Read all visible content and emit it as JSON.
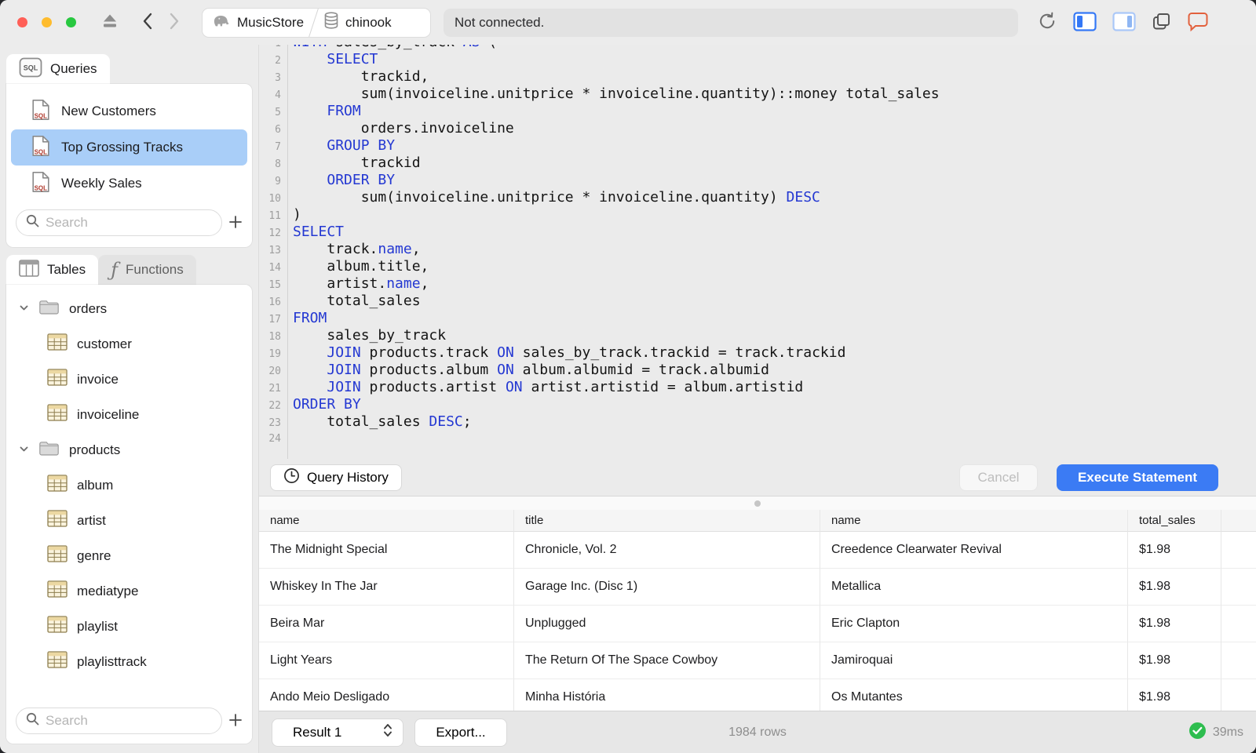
{
  "colors": {
    "accent_blue": "#3b7bf4",
    "selection_blue": "#a9cef8",
    "keyword_blue": "#2438d2",
    "success_green": "#2ebd4f",
    "chat_orange": "#e2603c",
    "traffic_red": "#ff5f57",
    "traffic_yellow": "#febc2e",
    "traffic_green": "#28c840"
  },
  "toolbar": {
    "breadcrumb": {
      "app": "MusicStore",
      "database": "chinook"
    },
    "status_field": "Not connected."
  },
  "sidebar": {
    "queries_tab_label": "Queries",
    "queries": [
      "New Customers",
      "Top Grossing Tracks",
      "Weekly Sales"
    ],
    "selected_query_index": 1,
    "queries_search_placeholder": "Search",
    "tables_tab_label": "Tables",
    "functions_tab_label": "Functions",
    "tables_search_placeholder": "Search",
    "tables_tree": [
      {
        "type": "folder",
        "label": "orders",
        "expanded": true
      },
      {
        "type": "table",
        "label": "customer"
      },
      {
        "type": "table",
        "label": "invoice"
      },
      {
        "type": "table",
        "label": "invoiceline"
      },
      {
        "type": "folder",
        "label": "products",
        "expanded": true
      },
      {
        "type": "table",
        "label": "album"
      },
      {
        "type": "table",
        "label": "artist"
      },
      {
        "type": "table",
        "label": "genre"
      },
      {
        "type": "table",
        "label": "mediatype"
      },
      {
        "type": "table",
        "label": "playlist"
      },
      {
        "type": "table",
        "label": "playlisttrack"
      }
    ]
  },
  "editor": {
    "lines": [
      [
        [
          "k",
          "WITH"
        ],
        [
          "t",
          " sales_by_track "
        ],
        [
          "k",
          "AS"
        ],
        [
          "t",
          " ("
        ]
      ],
      [
        [
          "t",
          "    "
        ],
        [
          "k",
          "SELECT"
        ]
      ],
      [
        [
          "t",
          "        trackid,"
        ]
      ],
      [
        [
          "t",
          "        sum(invoiceline.unitprice * invoiceline.quantity)::money total_sales"
        ]
      ],
      [
        [
          "t",
          "    "
        ],
        [
          "k",
          "FROM"
        ]
      ],
      [
        [
          "t",
          "        orders.invoiceline"
        ]
      ],
      [
        [
          "t",
          "    "
        ],
        [
          "k",
          "GROUP BY"
        ]
      ],
      [
        [
          "t",
          "        trackid"
        ]
      ],
      [
        [
          "t",
          "    "
        ],
        [
          "k",
          "ORDER BY"
        ]
      ],
      [
        [
          "t",
          "        sum(invoiceline.unitprice * invoiceline.quantity) "
        ],
        [
          "k",
          "DESC"
        ]
      ],
      [
        [
          "t",
          ")"
        ]
      ],
      [
        [
          "k",
          "SELECT"
        ]
      ],
      [
        [
          "t",
          "    track."
        ],
        [
          "k",
          "name"
        ],
        [
          "t",
          ","
        ]
      ],
      [
        [
          "t",
          "    album.title,"
        ]
      ],
      [
        [
          "t",
          "    artist."
        ],
        [
          "k",
          "name"
        ],
        [
          "t",
          ","
        ]
      ],
      [
        [
          "t",
          "    total_sales"
        ]
      ],
      [
        [
          "k",
          "FROM"
        ]
      ],
      [
        [
          "t",
          "    sales_by_track"
        ]
      ],
      [
        [
          "t",
          "    "
        ],
        [
          "k",
          "JOIN"
        ],
        [
          "t",
          " products.track "
        ],
        [
          "k",
          "ON"
        ],
        [
          "t",
          " sales_by_track.trackid = track.trackid"
        ]
      ],
      [
        [
          "t",
          "    "
        ],
        [
          "k",
          "JOIN"
        ],
        [
          "t",
          " products.album "
        ],
        [
          "k",
          "ON"
        ],
        [
          "t",
          " album.albumid = track.albumid"
        ]
      ],
      [
        [
          "t",
          "    "
        ],
        [
          "k",
          "JOIN"
        ],
        [
          "t",
          " products.artist "
        ],
        [
          "k",
          "ON"
        ],
        [
          "t",
          " artist.artistid = album.artistid"
        ]
      ],
      [
        [
          "k",
          "ORDER BY"
        ]
      ],
      [
        [
          "t",
          "    total_sales "
        ],
        [
          "k",
          "DESC"
        ],
        [
          "t",
          ";"
        ]
      ],
      []
    ]
  },
  "actions": {
    "query_history_label": "Query History",
    "cancel_label": "Cancel",
    "execute_label": "Execute Statement"
  },
  "results": {
    "columns": [
      "name",
      "title",
      "name",
      "total_sales"
    ],
    "rows": [
      [
        "The Midnight Special",
        "Chronicle, Vol. 2",
        "Creedence Clearwater Revival",
        "$1.98"
      ],
      [
        "Whiskey In The Jar",
        "Garage Inc. (Disc 1)",
        "Metallica",
        "$1.98"
      ],
      [
        "Beira Mar",
        "Unplugged",
        "Eric Clapton",
        "$1.98"
      ],
      [
        "Light Years",
        "The Return Of The Space Cowboy",
        "Jamiroquai",
        "$1.98"
      ],
      [
        "Ando Meio Desligado",
        "Minha História",
        "Os Mutantes",
        "$1.98"
      ]
    ]
  },
  "statusbar": {
    "result_selector_label": "Result 1",
    "export_label": "Export...",
    "rows_count": "1984 rows",
    "duration": "39ms"
  }
}
